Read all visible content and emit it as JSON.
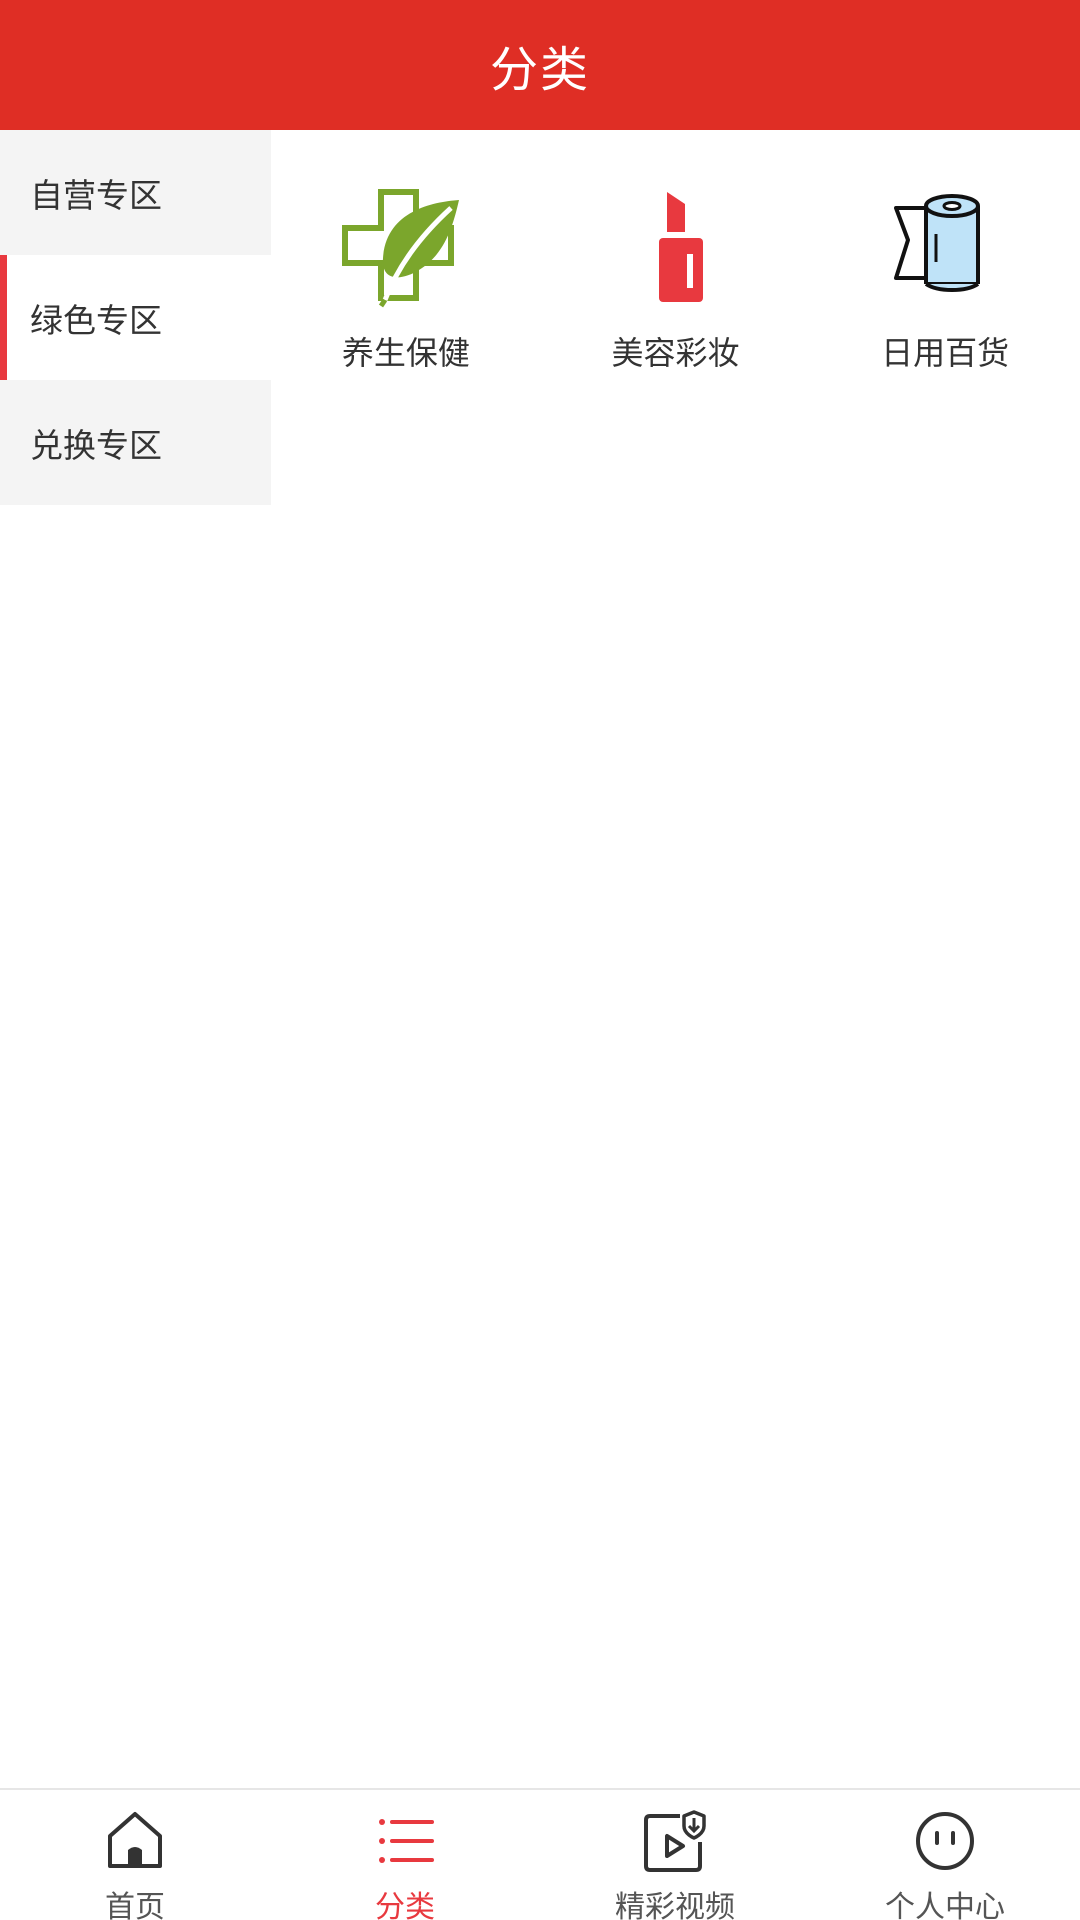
{
  "header": {
    "title": "分类"
  },
  "colors": {
    "header_bg": "#df2e25",
    "accent": "#e8393f",
    "sidebar_bg": "#f4f4f4",
    "health_icon": "#7ba62c",
    "lipstick_icon": "#e8393f",
    "tissue_icon": "#bfe3f8"
  },
  "sidebar": {
    "items": [
      {
        "label": "自营专区",
        "active": false
      },
      {
        "label": "绿色专区",
        "active": true
      },
      {
        "label": "兑换专区",
        "active": false
      }
    ]
  },
  "categories": [
    {
      "label": "养生保健",
      "icon": "health-cross-leaf-icon"
    },
    {
      "label": "美容彩妆",
      "icon": "lipstick-icon"
    },
    {
      "label": "日用百货",
      "icon": "tissue-roll-icon"
    }
  ],
  "tabbar": {
    "items": [
      {
        "label": "首页",
        "icon": "home-icon",
        "active": false
      },
      {
        "label": "分类",
        "icon": "list-icon",
        "active": true
      },
      {
        "label": "精彩视频",
        "icon": "video-icon",
        "active": false
      },
      {
        "label": "个人中心",
        "icon": "face-icon",
        "active": false
      }
    ]
  }
}
